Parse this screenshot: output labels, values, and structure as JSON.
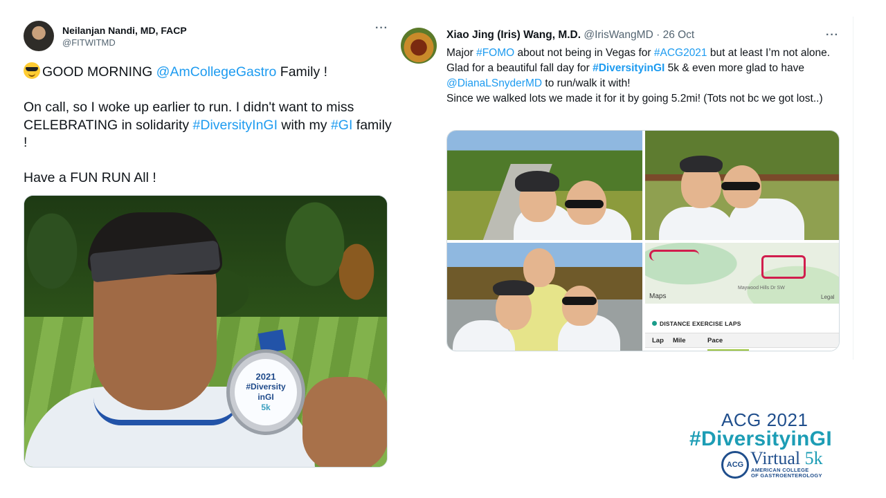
{
  "tweet_left": {
    "author_name": "Neilanjan Nandi, MD, FACP",
    "author_handle": "@FITWITMD",
    "text_parts": {
      "p1": "GOOD MORNING ",
      "mention": "@AmCollegeGastro",
      "p2": " Family !\n\nOn call, so I woke up earlier to run. I didn't want to miss CELEBRATING in solidarity ",
      "tag1": "#DiversityInGI",
      "p3": " with my ",
      "tag2": "#GI",
      "p4": " family !\n\nHave a FUN RUN All !"
    },
    "medal": {
      "year": "2021",
      "line1": "#Diversity",
      "line2": "inGI",
      "line3": "5k"
    }
  },
  "tweet_right": {
    "author_name": "Xiao Jing (Iris) Wang, M.D.",
    "author_handle": "@IrisWangMD",
    "separator": "·",
    "date": "26 Oct",
    "text_parts": {
      "p1": "Major ",
      "tag1": "#FOMO",
      "p2": " about not being in Vegas for ",
      "tag2": "#ACG2021",
      "p3": " but at least I’m not alone. Glad for a beautiful fall day for ",
      "tag3": "#DiversityinGI",
      "p4": " 5k & even more glad to have ",
      "mention": "@DianaLSnyderMD",
      "p5": " to run/walk it with!\nSince we walked lots we made it for it by going 5.2mi! (Tots not bc we got lost..)"
    },
    "map": {
      "maps_label": "Maps",
      "legal_label": "Legal",
      "road_label": "Maywood Hills Dr SW",
      "laps_title": "DISTANCE EXERCISE LAPS",
      "columns": [
        "Lap",
        "Mile",
        "Pace"
      ]
    }
  },
  "logo": {
    "line1": "ACG 2021",
    "line2": "#DiversityinGI",
    "seal": "ACG",
    "virtual": "Virtual",
    "five_k": "5k",
    "org_line1": "AMERICAN COLLEGE",
    "org_line2": "OF GASTROENTEROLOGY"
  },
  "colors": {
    "link": "#1d9bf0",
    "acg_blue": "#1f4e8c",
    "acg_teal": "#1d9db5"
  },
  "icons": {
    "more": "more-horizontal-icon",
    "pin": "location-pin-icon"
  }
}
